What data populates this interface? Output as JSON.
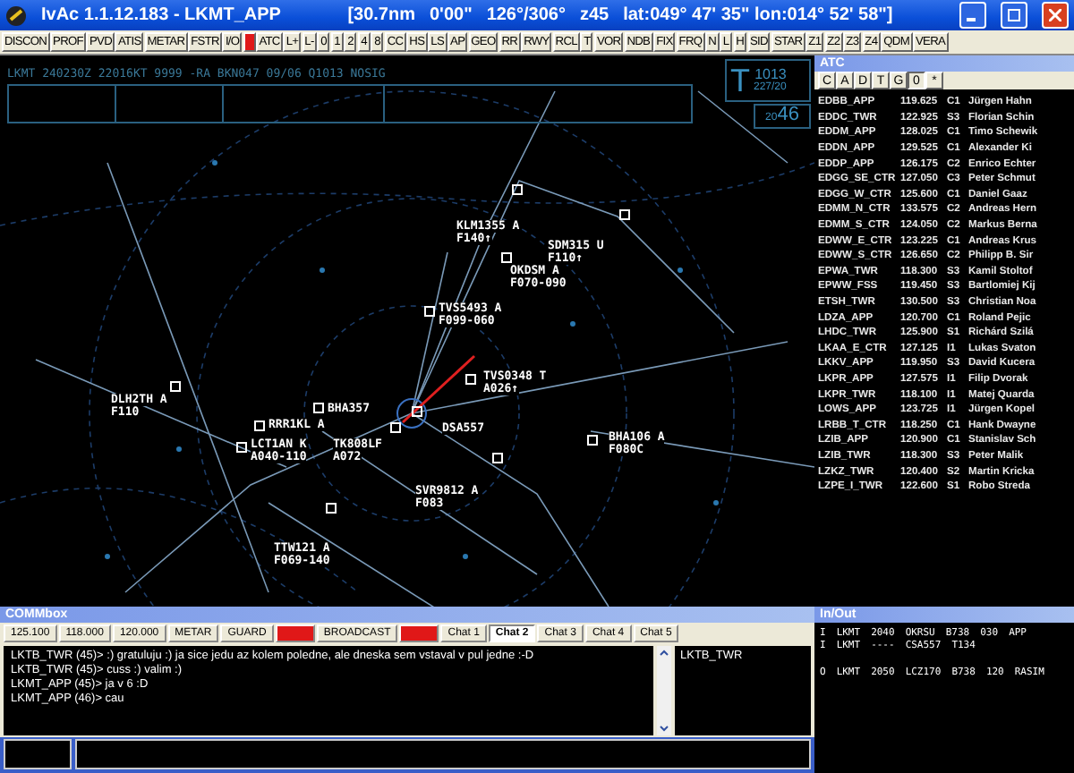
{
  "window": {
    "title": "IvAc 1.1.12.183  - LKMT_APP",
    "readout": [
      "[30.7nm",
      "0'00\"",
      "126°/306°",
      "z45",
      "lat:049° 47' 35\" lon:014° 52' 58\"]"
    ]
  },
  "toolbar": [
    {
      "label": "DISCON",
      "on": false
    },
    {
      "label": "PROF",
      "on": false
    },
    {
      "label": "PVD",
      "on": false
    },
    {
      "label": "ATIS",
      "on": false
    },
    {
      "label": "METAR",
      "on": false
    },
    {
      "label": "FSTR",
      "on": false
    },
    {
      "label": "I/O",
      "on": false
    },
    {
      "on": true
    },
    {
      "label": "ATC",
      "on": false
    },
    {
      "label": "L+",
      "on": false
    },
    {
      "label": "L-",
      "on": false
    },
    {
      "label": "0",
      "on": false
    },
    {
      "label": "1",
      "on": false
    },
    {
      "label": "2",
      "on": false
    },
    {
      "label": "4",
      "on": false
    },
    {
      "label": "8",
      "on": false
    },
    {
      "label": "CC",
      "on": false
    },
    {
      "label": "HS",
      "on": false
    },
    {
      "label": "LS",
      "on": false
    },
    {
      "label": "AP",
      "on": false
    },
    {
      "label": "GEO",
      "on": false
    },
    {
      "label": "RR",
      "on": false
    },
    {
      "label": "RWY",
      "on": false
    },
    {
      "label": "RCL",
      "on": false
    },
    {
      "label": "T",
      "on": false
    },
    {
      "label": "VOR",
      "on": false
    },
    {
      "label": "NDB",
      "on": false
    },
    {
      "label": "FIX",
      "on": false
    },
    {
      "label": "FRQ",
      "on": false
    },
    {
      "label": "N",
      "on": false
    },
    {
      "label": "L",
      "on": false
    },
    {
      "label": "H",
      "on": false
    },
    {
      "label": "SID",
      "on": false
    },
    {
      "label": "STAR",
      "on": false
    },
    {
      "label": "Z1",
      "on": false
    },
    {
      "label": "Z2",
      "on": false
    },
    {
      "label": "Z3",
      "on": false
    },
    {
      "label": "Z4",
      "on": false
    },
    {
      "label": "QDM",
      "on": false
    },
    {
      "label": "VERA",
      "on": false
    }
  ],
  "radar": {
    "metar": "LKMT 240230Z 22016KT 9999 -RA BKN047 09/06 Q1013 NOSIG",
    "pressure_mode": "T",
    "qnh": "1013",
    "wind": "227/20",
    "clock_hours": "20",
    "clock_minutes": "46",
    "aircraft": [
      {
        "callsign": "KLM1355 A",
        "level": "F140↑"
      },
      {
        "callsign": "SDM315 U",
        "level": "F110↑"
      },
      {
        "callsign": "OKDSM A",
        "level": "F070-090"
      },
      {
        "callsign": "TVS5493 A",
        "level": "F099-060"
      },
      {
        "callsign": "TVS0348 T",
        "level": "A026↑"
      },
      {
        "callsign": "BHA357"
      },
      {
        "callsign": "DSA557"
      },
      {
        "callsign": "DLH2TH A",
        "level": "F110"
      },
      {
        "callsign": "RRR1KL A"
      },
      {
        "callsign": "LCT1AN K",
        "level": "A040-110"
      },
      {
        "callsign": "TK808LF",
        "level": "A072"
      },
      {
        "callsign": "SVR9812 A",
        "level": "F083"
      },
      {
        "callsign": "BHA106 A",
        "level": "F080C"
      },
      {
        "callsign": "TTW121 A",
        "level": "F069-140"
      }
    ]
  },
  "atc": {
    "title": "ATC",
    "filters": [
      {
        "label": "C",
        "selected": false
      },
      {
        "label": "A",
        "selected": false
      },
      {
        "label": "D",
        "selected": false
      },
      {
        "label": "T",
        "selected": false
      },
      {
        "label": "G",
        "selected": false
      },
      {
        "label": "0",
        "selected": true
      },
      {
        "label": "*",
        "selected": false
      }
    ],
    "rows": [
      [
        "EDBB_APP",
        "119.625",
        "C1",
        "Jürgen Hahn"
      ],
      [
        "EDDC_TWR",
        "122.925",
        "S3",
        "Florian Schin"
      ],
      [
        "EDDM_APP",
        "128.025",
        "C1",
        "Timo Schewik"
      ],
      [
        "EDDN_APP",
        "129.525",
        "C1",
        "Alexander Ki"
      ],
      [
        "EDDP_APP",
        "126.175",
        "C2",
        "Enrico Echter"
      ],
      [
        "EDGG_SE_CTR",
        "127.050",
        "C3",
        "Peter Schmut"
      ],
      [
        "EDGG_W_CTR",
        "125.600",
        "C1",
        "Daniel Gaaz"
      ],
      [
        "EDMM_N_CTR",
        "133.575",
        "C2",
        "Andreas Hern"
      ],
      [
        "EDMM_S_CTR",
        "124.050",
        "C2",
        "Markus Berna"
      ],
      [
        "EDWW_E_CTR",
        "123.225",
        "C1",
        "Andreas Krus"
      ],
      [
        "EDWW_S_CTR",
        "126.650",
        "C2",
        "Philipp B. Sir"
      ],
      [
        "EPWA_TWR",
        "118.300",
        "S3",
        "Kamil Stoltof"
      ],
      [
        "EPWW_FSS",
        "119.450",
        "S3",
        "Bartlomiej Kij"
      ],
      [
        "ETSH_TWR",
        "130.500",
        "S3",
        "Christian Noa"
      ],
      [
        "LDZA_APP",
        "120.700",
        "C1",
        "Roland Pejic"
      ],
      [
        "LHDC_TWR",
        "125.900",
        "S1",
        "Richárd Szilá"
      ],
      [
        "LKAA_E_CTR",
        "127.125",
        "I1",
        "Lukas Svaton"
      ],
      [
        "LKKV_APP",
        "119.950",
        "S3",
        "David Kucera"
      ],
      [
        "LKPR_APP",
        "127.575",
        "I1",
        "Filip Dvorak"
      ],
      [
        "LKPR_TWR",
        "118.100",
        "I1",
        "Matej Quarda"
      ],
      [
        "LOWS_APP",
        "123.725",
        "I1",
        "Jürgen Kopel"
      ],
      [
        "LRBB_T_CTR",
        "118.250",
        "C1",
        "Hank Dwayne"
      ],
      [
        "LZIB_APP",
        "120.900",
        "C1",
        "Stanislav Sch"
      ],
      [
        "LZIB_TWR",
        "118.300",
        "S3",
        "Peter Malik"
      ],
      [
        "LZKZ_TWR",
        "120.400",
        "S2",
        "Martin Kricka"
      ],
      [
        "LZPE_I_TWR",
        "122.600",
        "S1",
        "Robo Streda"
      ]
    ]
  },
  "commbox": {
    "title": "COMMbox",
    "tabs": [
      {
        "label": "125.100",
        "selected": false,
        "alert": false
      },
      {
        "label": "118.000",
        "selected": false,
        "alert": false
      },
      {
        "label": "120.000",
        "selected": false,
        "alert": false
      },
      {
        "label": "METAR",
        "selected": false,
        "alert": false
      },
      {
        "label": "GUARD",
        "selected": false,
        "alert": false
      },
      {
        "selected": false,
        "alert": true
      },
      {
        "label": "BROADCAST",
        "selected": false,
        "alert": false
      },
      {
        "selected": false,
        "alert": true
      },
      {
        "label": "Chat 1",
        "selected": false,
        "alert": false
      },
      {
        "label": "Chat 2",
        "selected": true,
        "alert": false
      },
      {
        "label": "Chat 3",
        "selected": false,
        "alert": false
      },
      {
        "label": "Chat 4",
        "selected": false,
        "alert": false
      },
      {
        "label": "Chat 5",
        "selected": false,
        "alert": false
      }
    ],
    "messages": [
      "LKTB_TWR (45)> :) gratuluju :) ja sice jedu az kolem poledne, ale dneska sem vstaval v pul jedne :-D",
      "LKTB_TWR (45)> cuss :) valim :)",
      "LKMT_APP (45)> ja v 6 :D",
      "LKMT_APP (46)> cau"
    ],
    "users": [
      "LKTB_TWR"
    ]
  },
  "inout": {
    "title": "In/Out",
    "inbound": [
      [
        "I",
        "LKMT",
        "2040",
        "OKRSU",
        "B738",
        "030",
        "APP"
      ],
      [
        "I",
        "LKMT",
        "----",
        "CSA557",
        "T134"
      ]
    ],
    "outbound": [
      [
        "O",
        "LKMT",
        "2050",
        "LCZ170",
        "B738",
        "120",
        "RASIM"
      ]
    ]
  }
}
